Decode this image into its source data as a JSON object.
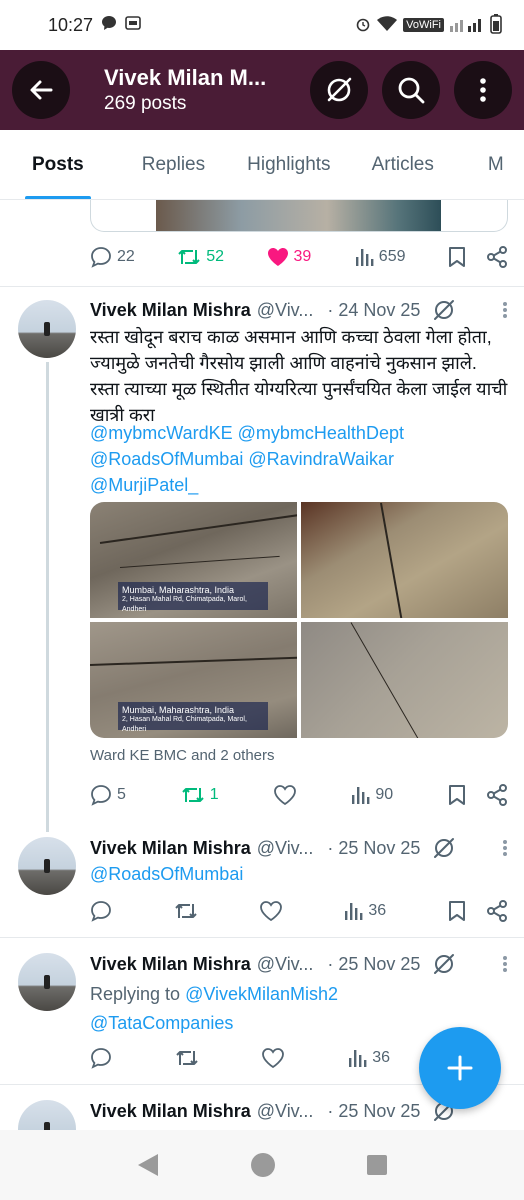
{
  "status": {
    "time": "10:27",
    "vowifi": "VoWiFi"
  },
  "header": {
    "title": "Vivek Milan M...",
    "posts_count": "269 posts"
  },
  "tabs": [
    {
      "label": "Posts",
      "active": true
    },
    {
      "label": "Replies"
    },
    {
      "label": "Highlights"
    },
    {
      "label": "Articles"
    },
    {
      "label": "M"
    }
  ],
  "post0": {
    "replies": "22",
    "reposts": "52",
    "likes": "39",
    "views": "659"
  },
  "post1": {
    "name": "Vivek Milan Mishra",
    "handle": "@Viv...",
    "date": "· 24 Nov 25",
    "text": "रस्ता खोदून बराच काळ असमान आणि कच्चा ठेवला गेला होता, ज्यामुळे जनतेची गैरसोय झाली आणि वाहनांचे नुकसान झाले. रस्ता त्याच्या मूळ स्थितीत योग्यरित्या पुनर्संचयित केला जाईल याची खात्री करा",
    "mentions": [
      "@mybmcWardKE",
      "@mybmcHealthDept",
      "@RoadsOfMumbai",
      "@RavindraWaikar",
      "@MurjiPatel_"
    ],
    "geo_tag": "Mumbai, Maharashtra, India",
    "geo_tag_sub": "2, Hasan Mahal Rd, Chimatpada, Marol, Andheri",
    "attribution": "Ward KE BMC and 2 others",
    "replies": "5",
    "reposts": "1",
    "views": "90"
  },
  "post2": {
    "name": "Vivek Milan Mishra",
    "handle": "@Viv...",
    "date": "· 25 Nov 25",
    "mention": "@RoadsOfMumbai",
    "views": "36"
  },
  "post3": {
    "name": "Vivek Milan Mishra",
    "handle": "@Viv...",
    "date": "· 25 Nov 25",
    "replying_label": "Replying to",
    "replying_to": "@VivekMilanMish2",
    "mention": "@TataCompanies",
    "views": "36"
  },
  "post4": {
    "name": "Vivek Milan Mishra",
    "handle": "@Viv...",
    "date": "· 25 Nov 25"
  },
  "colors": {
    "accent": "#1d9bf0",
    "header_bg": "#4a1c36",
    "repost_green": "#00ba7c",
    "like_pink": "#f91880"
  }
}
